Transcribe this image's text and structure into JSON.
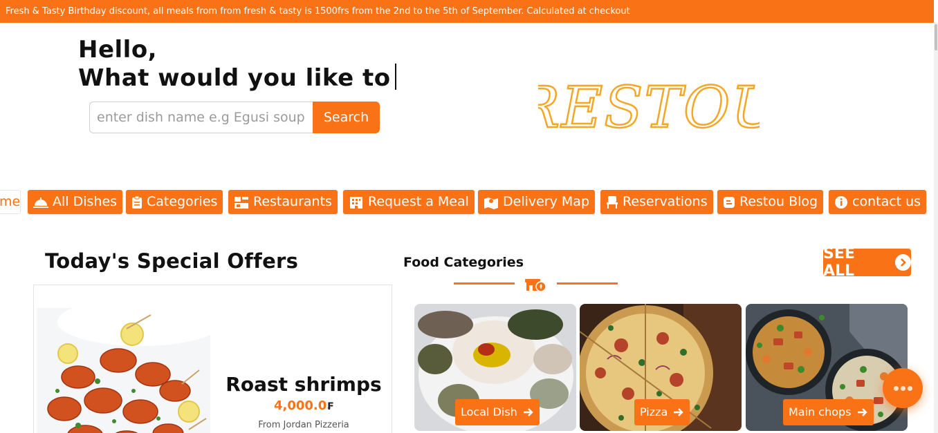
{
  "announcement": "Fresh & Tasty Birthday discount, all meals from from fresh & tasty is 1500frs from the 2nd to the 5th of September. Calculated at checkout",
  "hero": {
    "greeting": "Hello,",
    "question": "What would you like to"
  },
  "search": {
    "placeholder": "enter dish name e.g Egusi soup",
    "button_label": "Search"
  },
  "brand": {
    "logo_text": "RESTOU",
    "accent": "#f97316",
    "logo_color": "#f5a623"
  },
  "nav": {
    "home_partial": "me",
    "items": [
      {
        "label": "All Dishes",
        "icon": "cloche-icon"
      },
      {
        "label": "Categories",
        "icon": "clipboard-icon"
      },
      {
        "label": "Restaurants",
        "icon": "store-icon"
      },
      {
        "label": "Request a Meal",
        "icon": "building-icon"
      },
      {
        "label": "Delivery Map",
        "icon": "map-icon"
      },
      {
        "label": "Reservations",
        "icon": "chair-icon"
      },
      {
        "label": "Restou Blog",
        "icon": "blog-icon"
      },
      {
        "label": "contact us",
        "icon": "info-icon"
      }
    ]
  },
  "offers": {
    "title": "Today's Special Offers",
    "item": {
      "name": "Roast shrimps",
      "price": "4,000.0",
      "currency": "₣",
      "from": "From Jordan Pizzeria"
    }
  },
  "categories": {
    "title": "Food Categories",
    "see_all": "SEE ALL",
    "items": [
      {
        "label": "Local Dish"
      },
      {
        "label": "Pizza"
      },
      {
        "label": "Main chops"
      }
    ]
  }
}
